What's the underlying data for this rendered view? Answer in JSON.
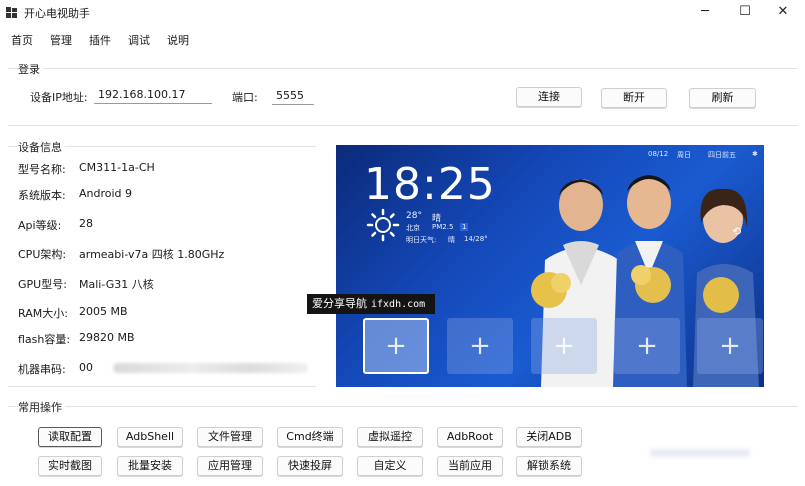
{
  "window": {
    "title": "开心电视助手",
    "min": "─",
    "max": "☐",
    "close": "✕"
  },
  "menu": [
    "首页",
    "管理",
    "插件",
    "调试",
    "说明"
  ],
  "login": {
    "section_title": "登录",
    "ip_label": "设备IP地址:",
    "ip_value": "192.168.100.17",
    "port_label": "端口:",
    "port_value": "5555",
    "connect": "连接",
    "disconnect": "断开",
    "refresh": "刷新"
  },
  "device": {
    "section_title": "设备信息",
    "rows": [
      {
        "label": "型号名称:",
        "value": "CM311-1a-CH"
      },
      {
        "label": "系统版本:",
        "value": "Android 9"
      },
      {
        "label": "Api等级:",
        "value": "28"
      },
      {
        "label": "CPU架构:",
        "value": "armeabi-v7a 四核 1.80GHz"
      },
      {
        "label": "GPU型号:",
        "value": "Mali-G31 八核"
      },
      {
        "label": "RAM大小:",
        "value": "2005 MB"
      },
      {
        "label": "flash容量:",
        "value": "29820 MB"
      },
      {
        "label": "机器串码:",
        "value": "00"
      }
    ]
  },
  "preview": {
    "time": "18:25",
    "date": "08/12",
    "weekday": "周日",
    "status_text": "四日前五",
    "temp": "28°",
    "condition": "晴",
    "city": "北京",
    "aqi": "PM2.5",
    "aqi_value": "1",
    "tomorrow": "明日天气:",
    "tomorrow_cond": "晴",
    "tomorrow_temp": "14/28°"
  },
  "ops": {
    "section_title": "常用操作",
    "row1": [
      "读取配置",
      "AdbShell",
      "文件管理",
      "Cmd终端",
      "虚拟遥控",
      "AdbRoot",
      "关闭ADB"
    ],
    "row2": [
      "实时截图",
      "批量安装",
      "应用管理",
      "快速投屏",
      "自定义",
      "当前应用",
      "解锁系统"
    ]
  },
  "watermark": {
    "text": "爱分享导航",
    "url": "ifxdh.com"
  }
}
